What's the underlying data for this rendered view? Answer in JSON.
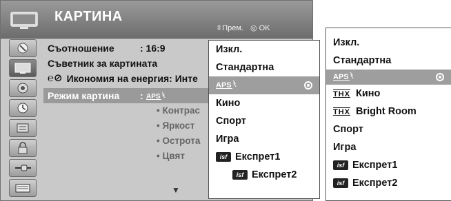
{
  "header": {
    "title": "КАРТИНА",
    "nav_hint": "Прем.",
    "ok_hint": "OK"
  },
  "sidebar": {
    "icons": [
      "satellite-icon",
      "picture-icon",
      "audio-icon",
      "clock-icon",
      "options-icon",
      "lock-icon",
      "input-icon",
      "usb-icon"
    ]
  },
  "menu": {
    "rows": [
      {
        "label": "Съотношение",
        "value": ": 16:9"
      },
      {
        "label": "Съветник за картината",
        "value": ""
      },
      {
        "label": "Икономия на енергия: Инте",
        "value": ""
      },
      {
        "label": "Режим картина",
        "value": ": "
      }
    ],
    "subitems": [
      "• Контрас",
      "• Яркост",
      "• Острота",
      "• Цвят"
    ],
    "down_arrow": "▼"
  },
  "dropdown": {
    "items": [
      {
        "label": "Изкл.",
        "type": "text"
      },
      {
        "label": "Стандартна",
        "type": "text"
      },
      {
        "label": "",
        "type": "aps",
        "selected": true
      },
      {
        "label": "Кино",
        "type": "text"
      },
      {
        "label": "Спорт",
        "type": "text"
      },
      {
        "label": "Игра",
        "type": "text"
      },
      {
        "label": "Експрет1",
        "type": "isf"
      },
      {
        "label": "Експрет2",
        "type": "isf"
      }
    ]
  },
  "list2": {
    "items": [
      {
        "label": "Изкл.",
        "type": "text"
      },
      {
        "label": "Стандартна",
        "type": "text"
      },
      {
        "label": "",
        "type": "aps",
        "selected": true
      },
      {
        "label": "Кино",
        "type": "thx"
      },
      {
        "label": "Bright Room",
        "type": "thx"
      },
      {
        "label": "Спорт",
        "type": "text"
      },
      {
        "label": "Игра",
        "type": "text"
      },
      {
        "label": "Експрет1",
        "type": "isf"
      },
      {
        "label": "Експрет2",
        "type": "isf"
      }
    ]
  },
  "logos": {
    "aps": "APS",
    "isf": "isf",
    "thx": "THX"
  },
  "colors": {
    "header": "#7f7f7f",
    "panel": "#c9c9c9",
    "selected": "#9e9e9e"
  }
}
